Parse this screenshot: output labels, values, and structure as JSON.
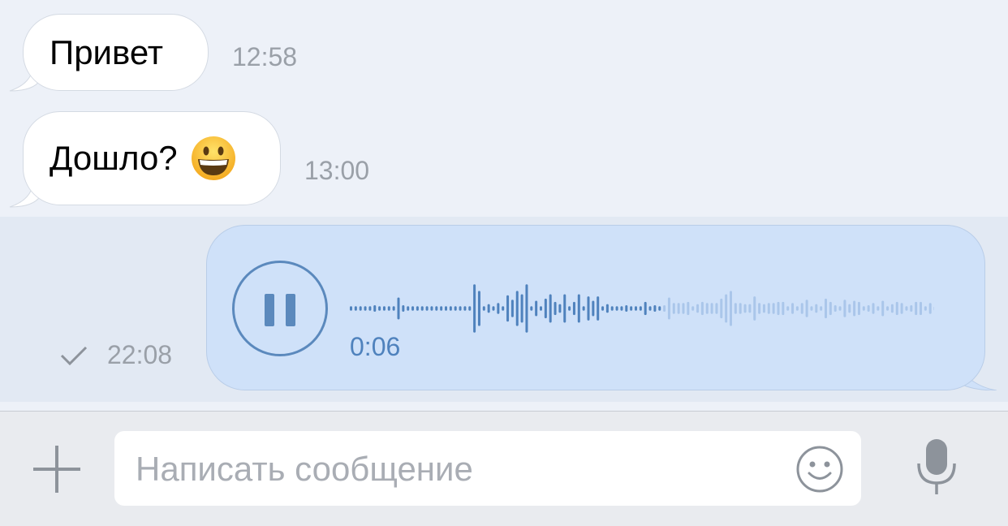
{
  "messages": {
    "m1": {
      "text": "Привет",
      "time": "12:58"
    },
    "m2": {
      "text": "Дошло?",
      "emoji": "grinning-face-emoji",
      "time": "13:00"
    },
    "voice": {
      "duration": "0:06",
      "time": "22:08",
      "status": "sent-check-icon"
    }
  },
  "composer": {
    "placeholder": "Написать сообщение"
  },
  "colors": {
    "background": "#edf1f8",
    "outgoing_bubble": "#cfe1f9",
    "accent": "#5b89bd",
    "muted_text": "#9aa0a8"
  }
}
